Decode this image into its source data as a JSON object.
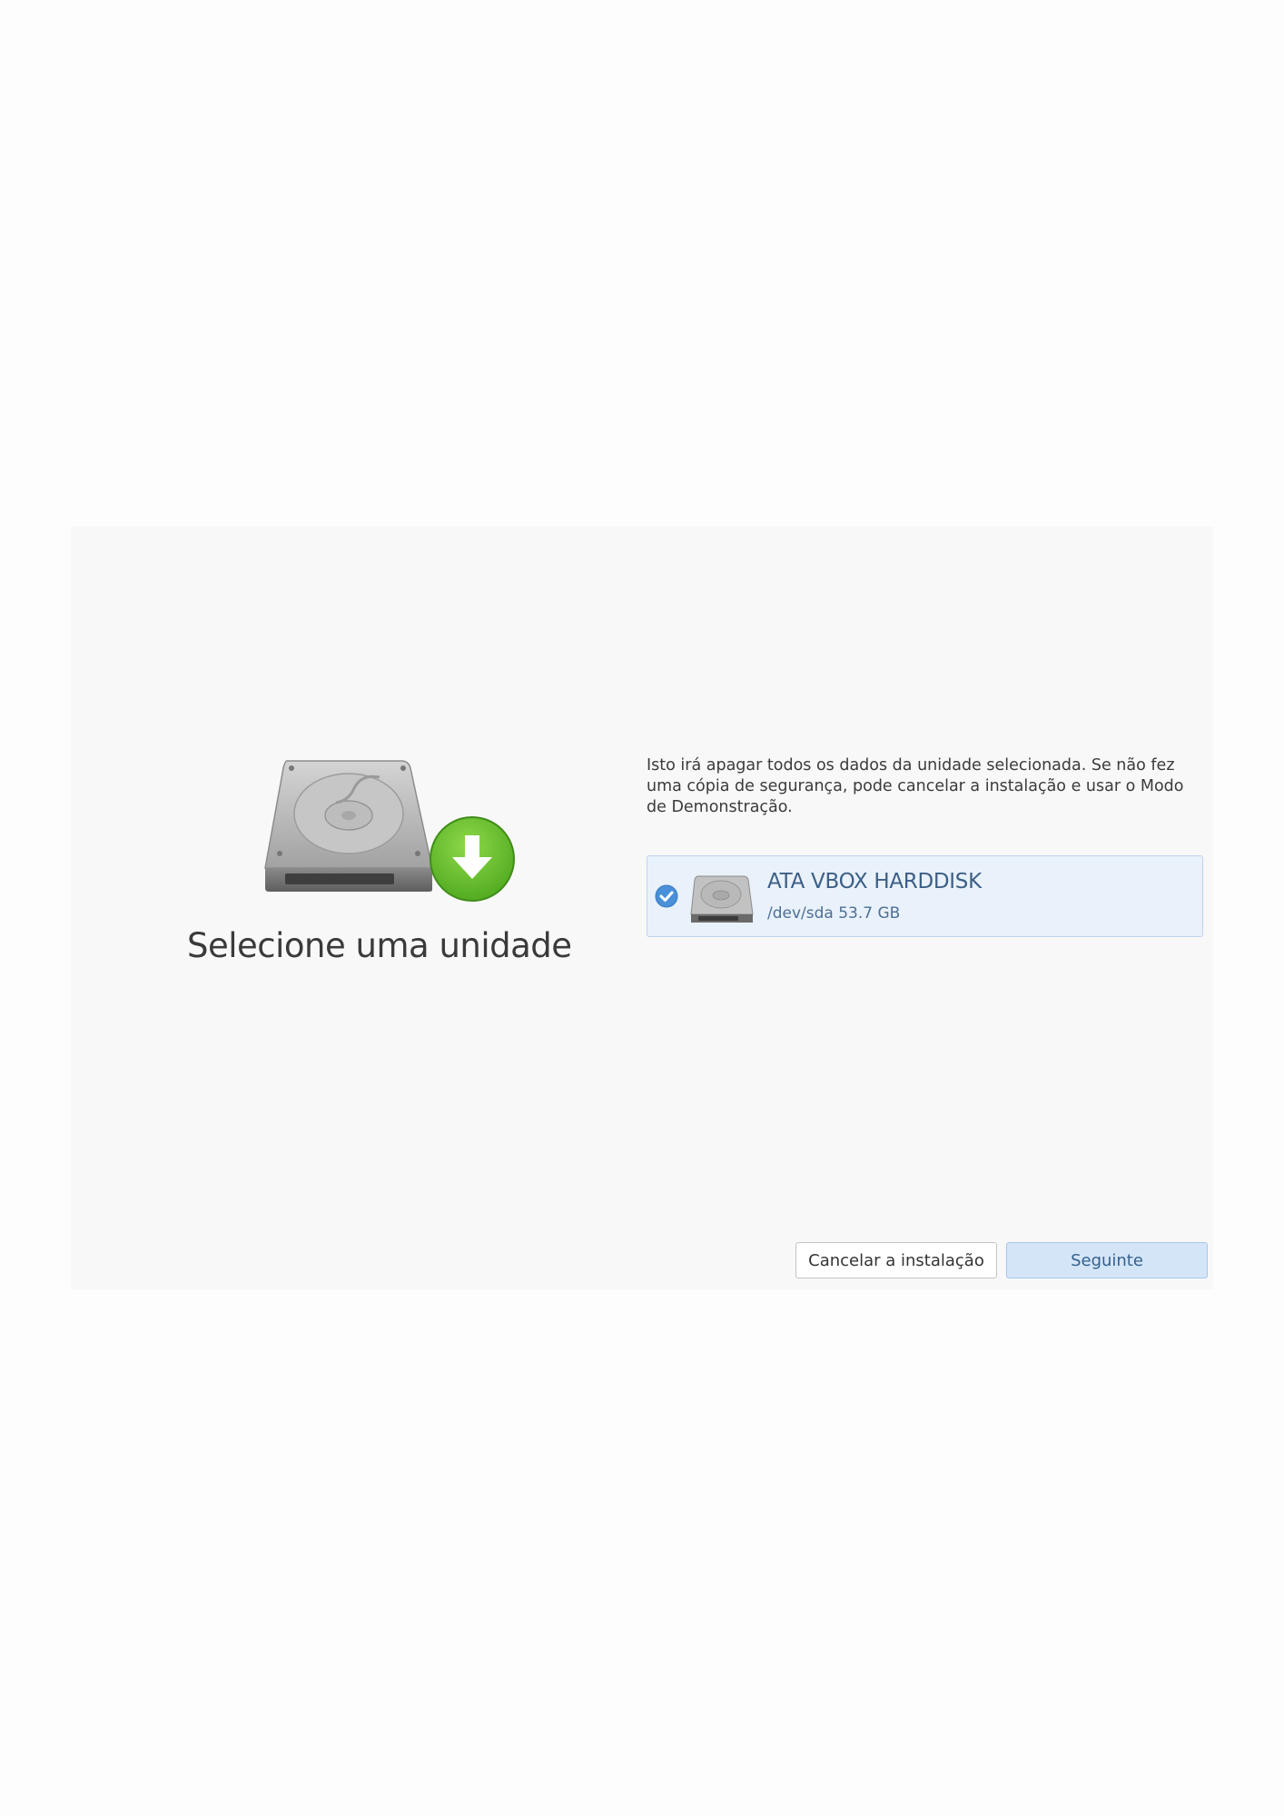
{
  "accent_color": "#3d5f86",
  "selection_color": "#e9f1fa",
  "hero": {
    "icon": "harddisk-download-icon",
    "title": "Selecione uma unidade"
  },
  "warning_text": "Isto irá apagar todos os dados da unidade selecionada. Se não fez uma cópia de segurança, pode cancelar a instalação e usar o Modo de Demonstração.",
  "drives": [
    {
      "name": "ATA VBOX HARDDISK",
      "detail": "/dev/sda 53.7 GB",
      "selected": true,
      "icon": "harddisk-icon"
    }
  ],
  "buttons": {
    "cancel_label": "Cancelar a instalação",
    "next_label": "Seguinte"
  }
}
